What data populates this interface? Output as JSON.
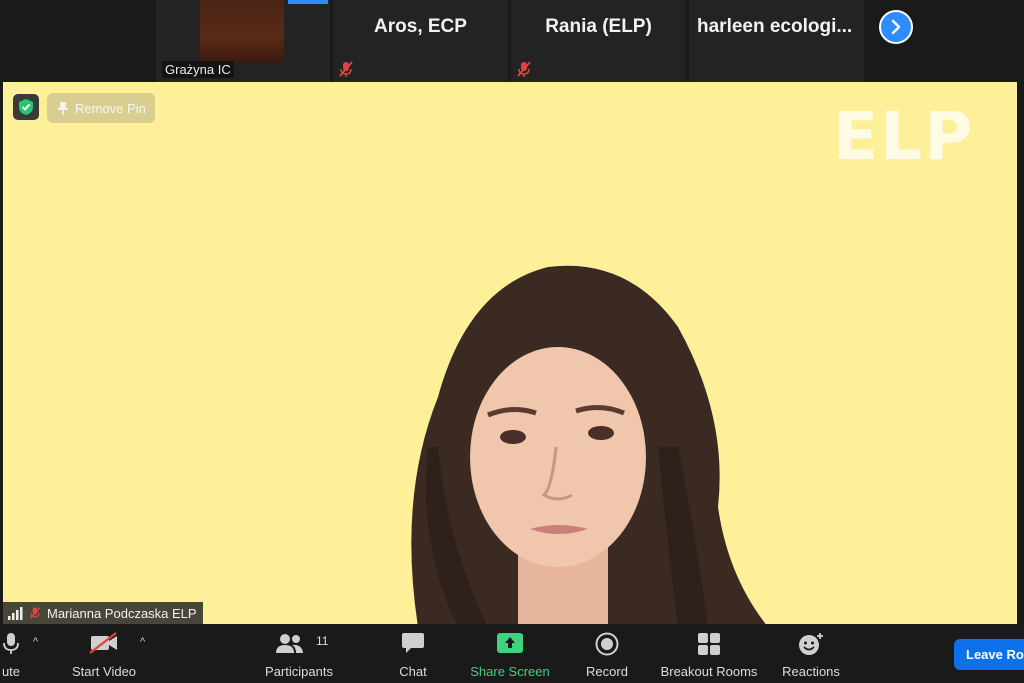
{
  "strip": {
    "tiles": [
      {
        "label": "Grażyna IC"
      },
      {
        "name": "Aros, ECP"
      },
      {
        "name": "Rania (ELP)"
      },
      {
        "name": "harleen  ecologi..."
      }
    ]
  },
  "main": {
    "remove_pin_label": "Remove Pin",
    "watermark": "ELP",
    "speaker_name": "Marianna Podczaska ELP"
  },
  "toolbar": {
    "mute_label": "ute",
    "start_video_label": "Start Video",
    "participants_label": "Participants",
    "participants_count": "11",
    "chat_label": "Chat",
    "share_screen_label": "Share Screen",
    "record_label": "Record",
    "breakout_rooms_label": "Breakout Rooms",
    "reactions_label": "Reactions",
    "leave_label": "Leave Ro"
  },
  "colors": {
    "accent": "#2d8cff",
    "share_green": "#3fd27f",
    "leave_blue": "#0e71eb",
    "mute_red": "#e0443e",
    "background_yellow": "#fdf099"
  },
  "icons": [
    "shield-icon",
    "pin-icon",
    "signal-icon",
    "mic-muted-icon",
    "mic-icon",
    "video-off-icon",
    "participants-icon",
    "chat-icon",
    "share-screen-icon",
    "record-icon",
    "breakout-rooms-icon",
    "reactions-icon",
    "chevron-right-icon"
  ]
}
